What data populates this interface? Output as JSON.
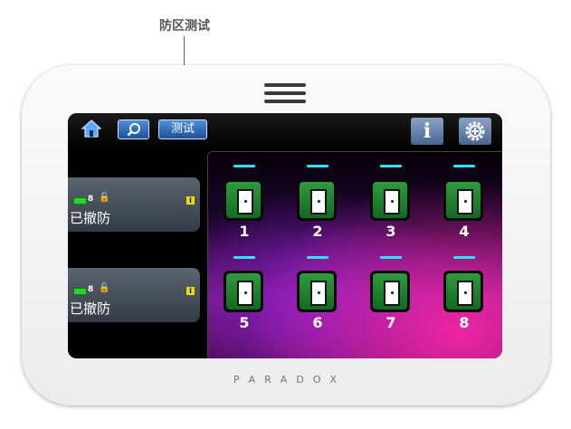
{
  "callout": {
    "label": "防区测试"
  },
  "topbar": {
    "home_icon": "home-icon",
    "search_icon": "search-icon",
    "test_label": "测试",
    "info_label": "i",
    "settings_icon": "settings-icon"
  },
  "areas": [
    {
      "battery": "8",
      "info": "i",
      "status": "已撤防"
    },
    {
      "battery": "8",
      "info": "i",
      "status": "已撤防"
    }
  ],
  "zones": [
    "1",
    "2",
    "3",
    "4",
    "5",
    "6",
    "7",
    "8"
  ],
  "brand": [
    "P",
    "A",
    "R",
    "A",
    "D",
    "O",
    "X"
  ],
  "colors": {
    "accent_blue": "#2e6cc0",
    "zone_green": "#2f9a3e",
    "indicator_cyan": "#2fe0ff",
    "battery_green": "#2bd42b"
  }
}
